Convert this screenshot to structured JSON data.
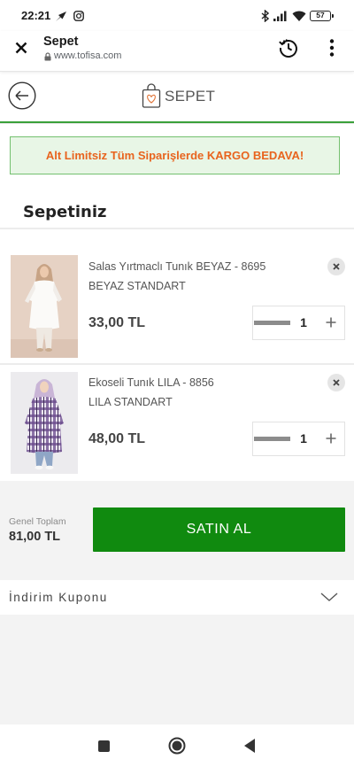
{
  "status_bar": {
    "time": "22:21",
    "battery_level": "57",
    "left_icons": [
      "app-notification-icon",
      "instagram-icon"
    ],
    "right_icons": [
      "bluetooth-icon",
      "signal-icon",
      "wifi-icon",
      "battery-icon"
    ]
  },
  "browser_toolbar": {
    "title": "Sepet",
    "url": "www.tofisa.com",
    "icons": [
      "close-icon",
      "lock-icon",
      "history-icon",
      "more-vert-icon"
    ]
  },
  "page_header": {
    "title": "SEPET",
    "icons": [
      "back-arrow-icon",
      "shopping-bag-icon"
    ]
  },
  "shipping_banner": {
    "text": "Alt Limitsiz Tüm Siparişlerde KARGO BEDAVA!"
  },
  "cart": {
    "heading": "Sepetiniz",
    "items": [
      {
        "name": "Salas Yırtmaclı Tunık BEYAZ - 8695",
        "variant": "BEYAZ STANDART",
        "price": "33,00 TL",
        "quantity": "1"
      },
      {
        "name": "Ekoseli Tunık LILA - 8856",
        "variant": "LILA STANDART",
        "price": "48,00 TL",
        "quantity": "1"
      }
    ],
    "item_icons": [
      "remove-icon",
      "minus-icon",
      "plus-icon"
    ]
  },
  "summary": {
    "total_label": "Genel Toplam",
    "total_value": "81,00 TL",
    "checkout_label": "SATIN AL"
  },
  "coupon": {
    "label": "İndirim Kuponu",
    "icon": "chevron-down-icon"
  },
  "nav_bar": {
    "icons": [
      "recents-icon",
      "home-icon",
      "back-icon"
    ]
  },
  "colors": {
    "accent_green": "#108a0f",
    "banner_text": "#e8641e",
    "banner_background": "#e8f6e6",
    "banner_border": "#74c06f",
    "page_gray": "#f3f3f3"
  }
}
